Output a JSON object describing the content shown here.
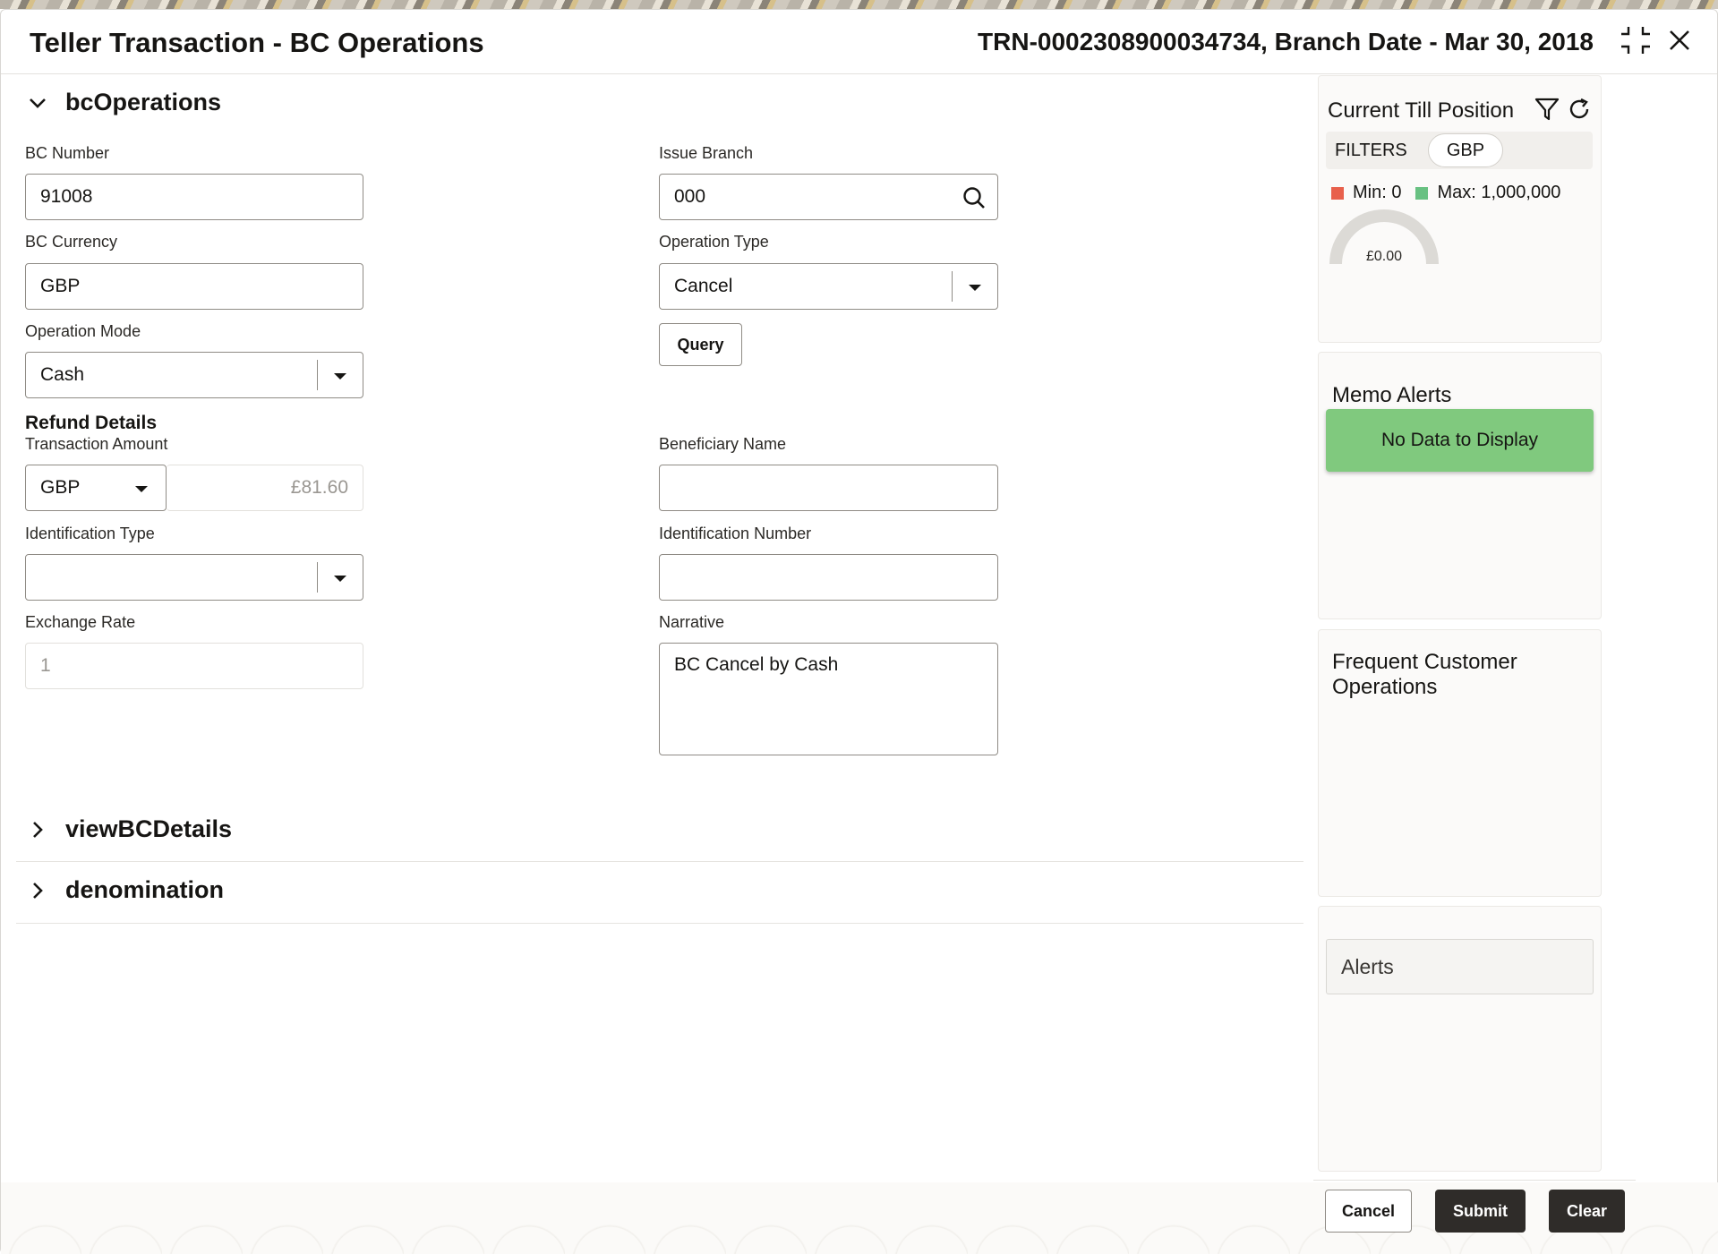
{
  "header": {
    "title": "Teller Transaction - BC Operations",
    "reference": "TRN-0002308900034734, Branch Date - Mar 30, 2018"
  },
  "sections": {
    "bc_operations": "bcOperations",
    "view_bc_details": "viewBCDetails",
    "denomination": "denomination"
  },
  "form": {
    "bc_number": {
      "label": "BC Number",
      "value": "91008"
    },
    "issue_branch": {
      "label": "Issue Branch",
      "value": "000"
    },
    "bc_currency": {
      "label": "BC Currency",
      "value": "GBP"
    },
    "operation_type": {
      "label": "Operation Type",
      "value": "Cancel"
    },
    "operation_mode": {
      "label": "Operation Mode",
      "value": "Cash"
    },
    "query_button": "Query",
    "refund_details": "Refund Details",
    "transaction_amount": {
      "label": "Transaction Amount",
      "currency": "GBP",
      "amount": "£81.60"
    },
    "beneficiary_name": {
      "label": "Beneficiary Name",
      "value": ""
    },
    "identification_type": {
      "label": "Identification Type",
      "value": ""
    },
    "identification_number": {
      "label": "Identification Number",
      "value": ""
    },
    "exchange_rate": {
      "label": "Exchange Rate",
      "value": "1"
    },
    "narrative": {
      "label": "Narrative",
      "value": "BC Cancel by Cash"
    }
  },
  "till_position": {
    "title": "Current Till Position",
    "filters_label": "FILTERS",
    "currency_chip": "GBP",
    "min_label": "Min: 0",
    "max_label": "Max: 1,000,000",
    "gauge_value": "£0.00",
    "gauge_fraction": 0,
    "min_color": "#e8604c",
    "max_color": "#68c182"
  },
  "memo_alerts": {
    "title": "Memo Alerts",
    "empty_text": "No Data to Display",
    "empty_color": "#80c97e"
  },
  "frequent_ops": {
    "title": "Frequent Customer Operations"
  },
  "alerts": {
    "title": "Alerts"
  },
  "footer": {
    "cancel": "Cancel",
    "submit": "Submit",
    "clear": "Clear"
  },
  "icons": [
    "compress-icon",
    "close-icon",
    "chevron-down-icon",
    "chevron-right-icon",
    "search-icon",
    "dropdown-arrow-icon",
    "filter-icon",
    "refresh-icon"
  ]
}
